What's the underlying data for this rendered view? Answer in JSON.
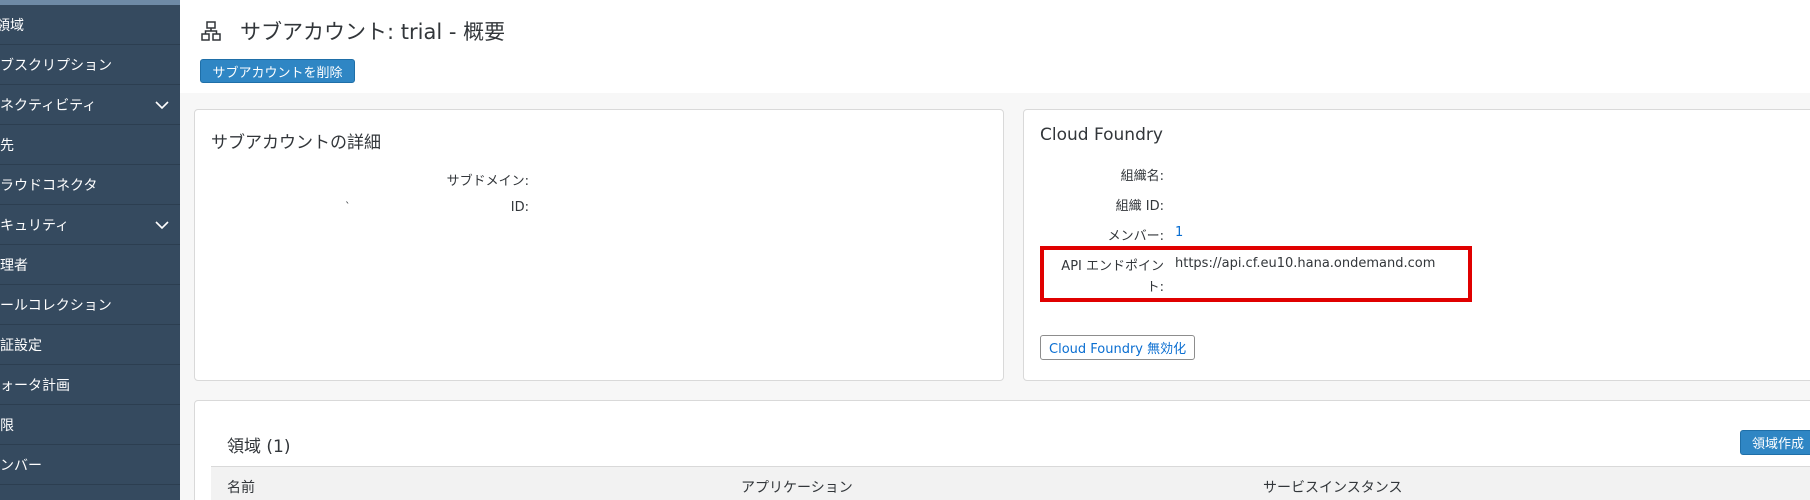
{
  "sidebar": {
    "items": [
      {
        "label": "領域",
        "expandable": false
      },
      {
        "label": "サブスクリプション",
        "expandable": false
      },
      {
        "label": "コネクティビティ",
        "expandable": true
      },
      {
        "label": "宛先",
        "expandable": false
      },
      {
        "label": "クラウドコネクタ",
        "expandable": false
      },
      {
        "label": "セキュリティ",
        "expandable": true
      },
      {
        "label": "管理者",
        "expandable": false
      },
      {
        "label": "ロールコレクション",
        "expandable": false
      },
      {
        "label": "認証設定",
        "expandable": false
      },
      {
        "label": "クォータ計画",
        "expandable": false
      },
      {
        "label": "制限",
        "expandable": false
      },
      {
        "label": "メンバー",
        "expandable": false
      }
    ]
  },
  "header": {
    "title": "サブアカウント: trial - 概要",
    "icon": "hierarchy-icon",
    "delete_button": "サブアカウントを削除"
  },
  "subaccount_details": {
    "title": "サブアカウントの詳細",
    "subdomain_label": "サブドメイン:",
    "subdomain_value": "",
    "id_label": "ID:",
    "id_value": "`"
  },
  "cloud_foundry": {
    "title": "Cloud Foundry",
    "org_name_label": "組織名:",
    "org_name_value": "",
    "org_id_label": "組織 ID:",
    "org_id_value": "",
    "members_label": "メンバー:",
    "members_value": "1",
    "api_label": "API エンドポイント:",
    "api_value": "https://api.cf.eu10.hana.ondemand.com",
    "disable_button": "Cloud Foundry 無効化"
  },
  "spaces": {
    "title": "領域 (1)",
    "create_button": "領域作成",
    "columns": [
      "名前",
      "アプリケーション",
      "サービスインスタンス"
    ]
  },
  "colors": {
    "sidebar_bg": "#354a5f",
    "emphasized_button": "#2f86c4",
    "link": "#0a6ed1",
    "highlight_border": "#e00000"
  }
}
